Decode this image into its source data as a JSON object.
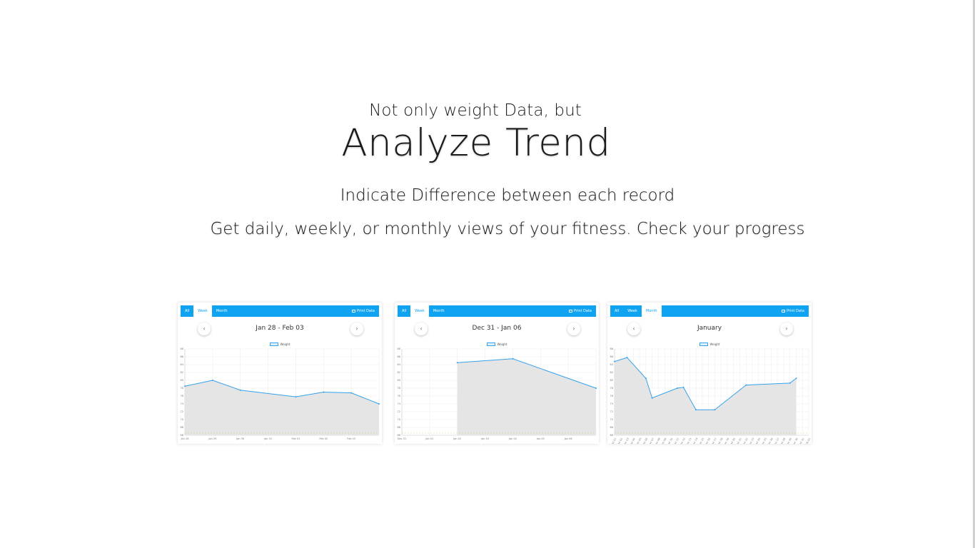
{
  "hero": {
    "eyebrow": "Not only weight Data, but",
    "title": "Analyze Trend",
    "subtitle": "Indicate Difference between each record",
    "tagline": "Get daily, weekly, or monthly views of your fitness. Check your progress"
  },
  "colors": {
    "accent": "#0fa3f2",
    "series_line": "#36a2eb",
    "area_fill": "#e5e5e5"
  },
  "screenshots": [
    {
      "tabs": [
        "All",
        "Week",
        "Month"
      ],
      "active_tab": "Week",
      "print_label": "Print Data",
      "range_label": "Jan 28 - Feb 03",
      "legend_label": "Weight",
      "chart_data": {
        "type": "area",
        "x": [
          "Jan 28",
          "Jan 29",
          "Jan 30",
          "Jan 31",
          "Feb 01",
          "Feb 02",
          "Feb 03",
          "Feb 04"
        ],
        "values": [
          78.5,
          80.0,
          77.5,
          null,
          75.8,
          77.0,
          76.8,
          74.0
        ],
        "ylim": [
          66,
          88
        ],
        "yticks": [
          66,
          68,
          70,
          72,
          74,
          76,
          78,
          80,
          82,
          84,
          86,
          88
        ],
        "xtick_labels": [
          "Jan 28",
          "Jan 29",
          "Jan 30",
          "Jan 31",
          "Feb 01",
          "Feb 02",
          "Feb 03"
        ],
        "legend": "top-center",
        "grid": true
      }
    },
    {
      "tabs": [
        "All",
        "Week",
        "Month"
      ],
      "active_tab": "Week",
      "print_label": "Print Data",
      "range_label": "Dec 31 - Jan 06",
      "legend_label": "Weight",
      "chart_data": {
        "type": "area",
        "x": [
          "Dec 31",
          "Jan 01",
          "Jan 02",
          "Jan 03",
          "Jan 04",
          "Jan 05",
          "Jan 06",
          "Jan 07"
        ],
        "values": [
          null,
          null,
          84.5,
          null,
          85.5,
          null,
          null,
          78.0
        ],
        "ylim": [
          66,
          88
        ],
        "yticks": [
          66,
          68,
          70,
          72,
          74,
          76,
          78,
          80,
          82,
          84,
          86,
          88
        ],
        "xtick_labels": [
          "Dec 31",
          "Jan 01",
          "Jan 02",
          "Jan 03",
          "Jan 04",
          "Jan 05",
          "Jan 06"
        ],
        "legend": "top-center",
        "grid": true
      }
    },
    {
      "tabs": [
        "All",
        "Week",
        "Month"
      ],
      "active_tab": "Month",
      "print_label": "Print Data",
      "range_label": "January",
      "legend_label": "Weight",
      "chart_data": {
        "type": "area",
        "x": [
          "Jan 01",
          "Jan 02",
          "Jan 03",
          "Jan 04",
          "Jan 05",
          "Jan 06",
          "Jan 07",
          "Jan 08",
          "Jan 09",
          "Jan 10",
          "Jan 11",
          "Jan 12",
          "Jan 13",
          "Jan 14",
          "Jan 15",
          "Jan 16",
          "Jan 17",
          "Jan 18",
          "Jan 19",
          "Jan 20",
          "Jan 21",
          "Jan 22",
          "Jan 23",
          "Jan 24",
          "Jan 25",
          "Jan 26",
          "Jan 27",
          "Jan 28",
          "Jan 29",
          "Jan 30",
          "Jan 31",
          "Feb 01"
        ],
        "values": [
          84.8,
          null,
          85.8,
          null,
          null,
          80.5,
          75.5,
          null,
          null,
          null,
          78.0,
          78.2,
          null,
          72.5,
          null,
          null,
          72.5,
          null,
          null,
          null,
          null,
          78.8,
          null,
          null,
          null,
          null,
          null,
          null,
          79.3,
          80.5,
          null,
          null
        ],
        "ylim": [
          66,
          88
        ],
        "yticks": [
          66,
          68,
          70,
          72,
          74,
          76,
          78,
          80,
          82,
          84,
          86,
          88
        ],
        "legend": "top-center",
        "grid": true
      }
    }
  ]
}
